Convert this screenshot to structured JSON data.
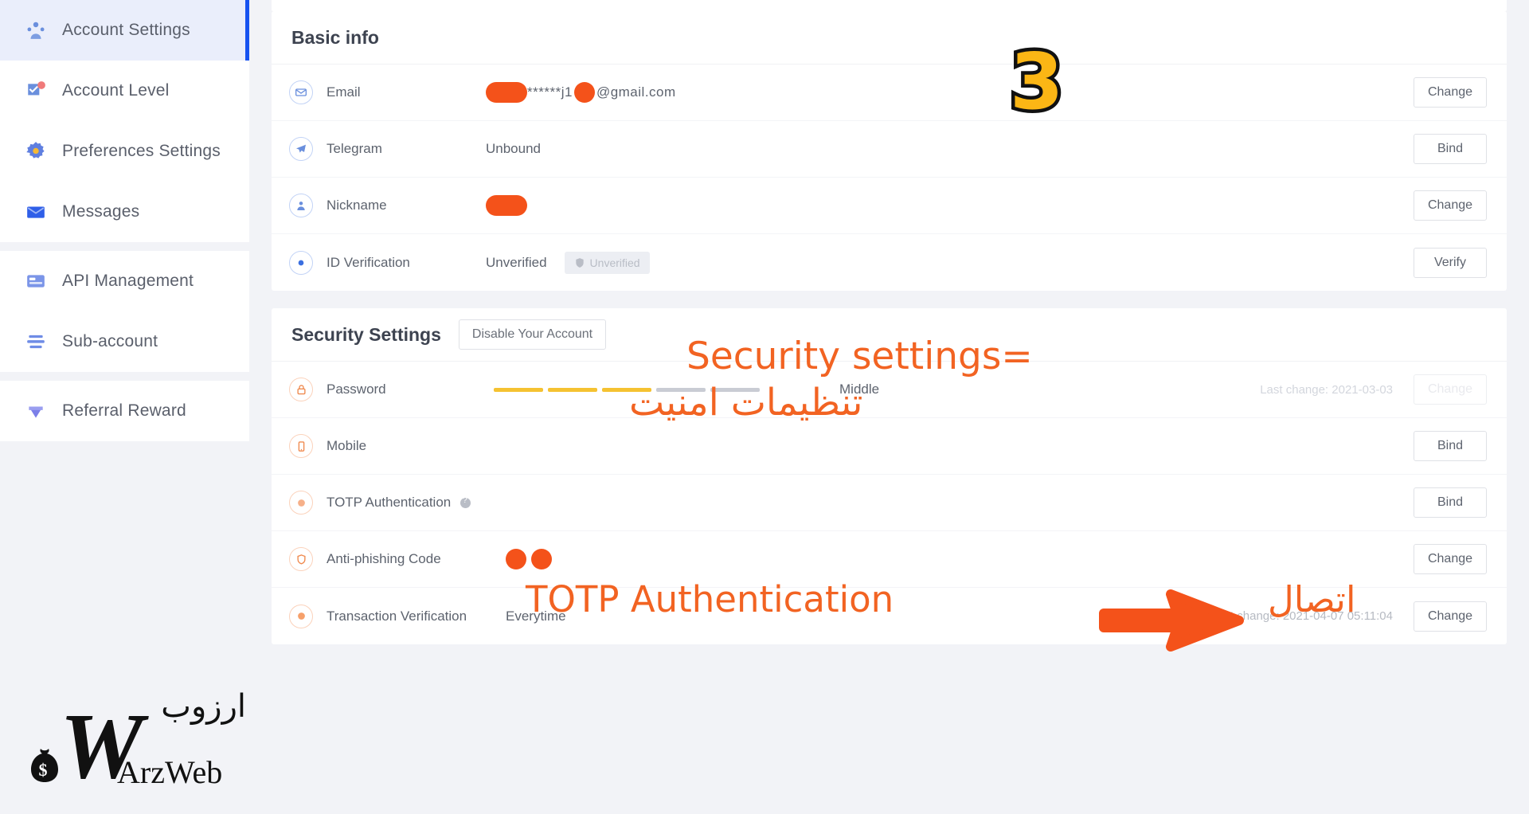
{
  "sidebar": {
    "groups": [
      {
        "items": [
          {
            "label": "Account Settings",
            "icon": "user-group-icon",
            "active": true
          },
          {
            "label": "Account Level",
            "icon": "badge-check-icon",
            "active": false
          },
          {
            "label": "Preferences Settings",
            "icon": "gear-icon",
            "active": false
          },
          {
            "label": "Messages",
            "icon": "envelope-icon",
            "active": false
          }
        ]
      },
      {
        "items": [
          {
            "label": "API Management",
            "icon": "card-icon",
            "active": false
          },
          {
            "label": "Sub-account",
            "icon": "layers-icon",
            "active": false
          }
        ]
      },
      {
        "items": [
          {
            "label": "Referral Reward",
            "icon": "gift-icon",
            "active": false
          }
        ]
      }
    ]
  },
  "basic_info": {
    "title": "Basic info",
    "rows": [
      {
        "label": "Email",
        "icon": "mail-circle-icon",
        "value_kind": "email",
        "value": "●●******j1●@gmail.com",
        "email_prefix_blob": true,
        "email_text": "******j1",
        "email_suffix": "@gmail.com",
        "button": "Change"
      },
      {
        "label": "Telegram",
        "icon": "telegram-circle-icon",
        "value_kind": "text",
        "value": "Unbound",
        "button": "Bind"
      },
      {
        "label": "Nickname",
        "icon": "person-circle-icon",
        "value_kind": "blob",
        "value": "",
        "button": "Change"
      },
      {
        "label": "ID Verification",
        "icon": "target-circle-icon",
        "value_kind": "chip",
        "value": "Unverified",
        "chip": "Unverified",
        "button": "Verify"
      }
    ]
  },
  "security_settings": {
    "title": "Security Settings",
    "disable_account_label": "Disable Your Account",
    "rows": [
      {
        "label": "Password",
        "icon": "lock-circle-icon",
        "value_kind": "strength",
        "strength_label": "Middle",
        "segments_on": 3,
        "segments_total": 5,
        "meta": "Last change: 2021-03-03",
        "meta_faded": true,
        "button": "Change",
        "button_ghost": true
      },
      {
        "label": "Mobile",
        "icon": "phone-circle-icon",
        "value_kind": "empty",
        "meta": "",
        "button": "Bind"
      },
      {
        "label": "TOTP Authentication",
        "icon": "dot-circle-icon",
        "value_kind": "empty",
        "has_help": true,
        "meta": "",
        "button": "Bind"
      },
      {
        "label": "Anti-phishing Code",
        "icon": "shield-circle-icon",
        "value_kind": "blobpair",
        "meta": "",
        "button": "Change"
      },
      {
        "label": "Transaction Verification",
        "icon": "dot-circle-icon",
        "value_kind": "text",
        "value": "Everytime",
        "meta": "Last change: 2021-04-07 05:11:04",
        "button": "Change"
      }
    ]
  },
  "annotations": {
    "step_badge": "3",
    "security_settings_en": "Security settings=",
    "security_settings_fa": "تنظیمات امنیت",
    "totp_en": "TOTP Authentication",
    "totp_fa": "اتصال",
    "arrow": "right-arrow-icon"
  },
  "watermark": {
    "fa": "ارزوب",
    "en": "ArzWeb",
    "mark": "W",
    "icon": "money-bag-icon"
  },
  "colors": {
    "accent_blue": "#1652f0",
    "annotation_orange": "#f26322",
    "blob_orange": "#f4521a",
    "badge_yellow": "#fbb615",
    "strength_yellow": "#f5c231",
    "text_primary": "#3d4350",
    "text_secondary": "#5d636e",
    "text_muted": "#b6bac2"
  }
}
